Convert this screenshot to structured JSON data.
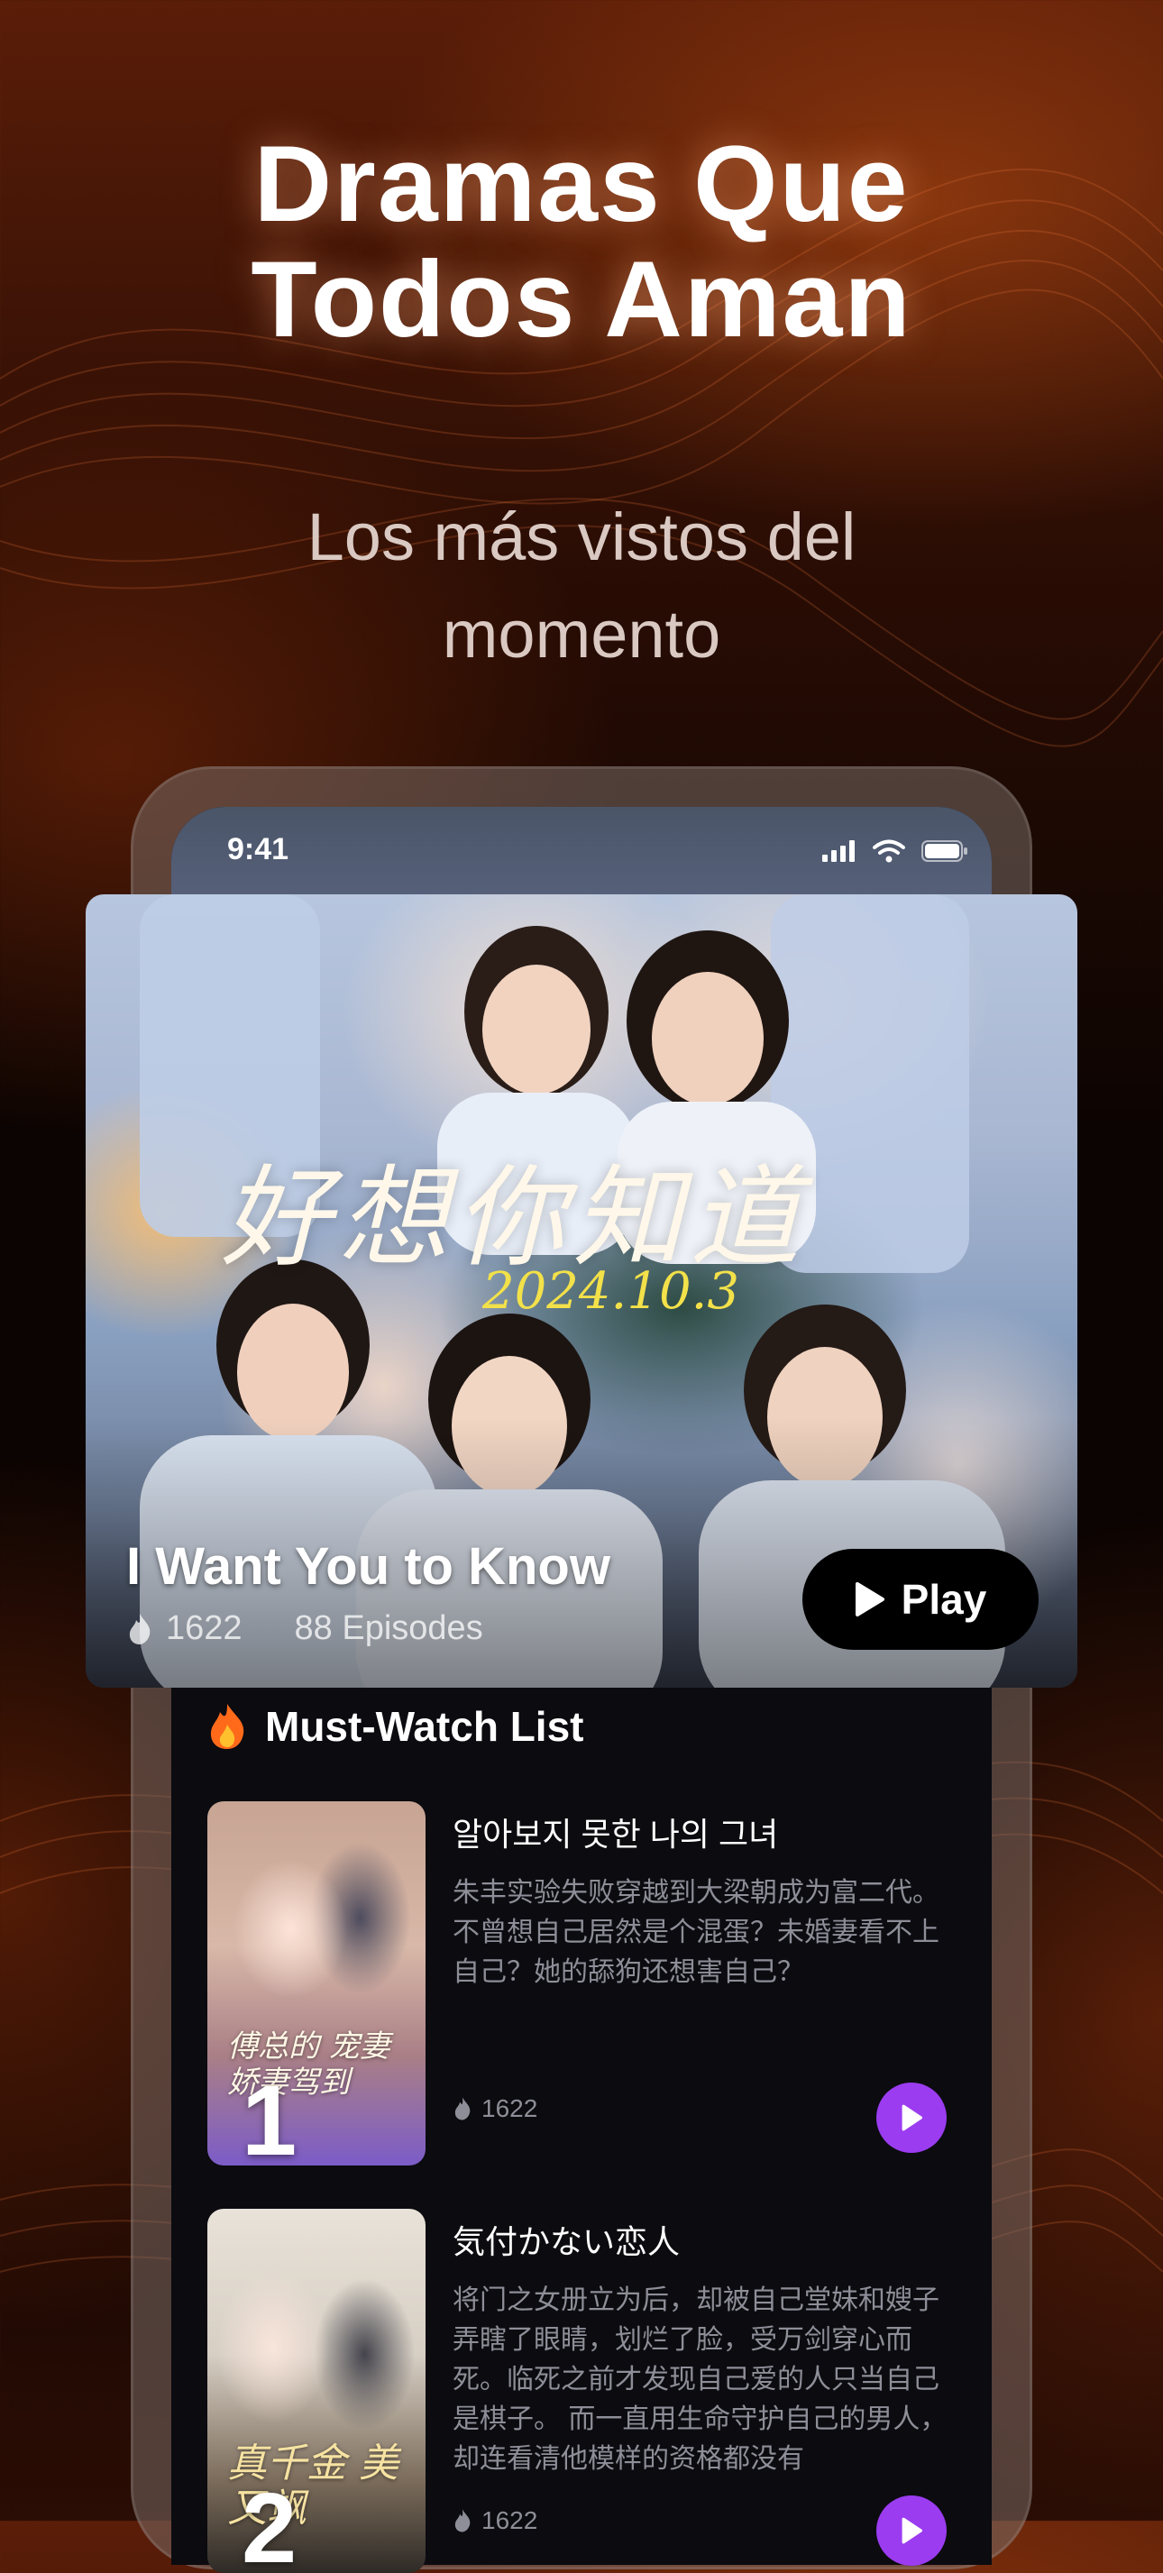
{
  "promo": {
    "headline_line1": "Dramas Que",
    "headline_line2": "Todos Aman",
    "subhead_line1": "Los más vistos del",
    "subhead_line2": "momento"
  },
  "status_bar": {
    "time": "9:41",
    "icons": [
      "signal-icon",
      "wifi-icon",
      "battery-icon"
    ]
  },
  "featured": {
    "poster_title_cn": "好想你知道",
    "poster_date": "2024.10.3",
    "title": "I Want You to Know",
    "views": "1622",
    "episodes": "88 Episodes",
    "play_label": "Play"
  },
  "list": {
    "section_title": "Must-Watch List",
    "section_icon": "fire-icon",
    "items": [
      {
        "rank": "1",
        "poster_text": "傅总的 宠妻 娇妻驾到",
        "title": "알아보지 못한 나의 그녀",
        "description": "朱丰实验失败穿越到大梁朝成为富二代。不曾想自己居然是个混蛋？未婚妻看不上自己？她的舔狗还想害自己？",
        "views": "1622"
      },
      {
        "rank": "2",
        "poster_text": "真千金 美又飒",
        "title": "気付かない恋人",
        "description": "将门之女册立为后，却被自己堂妹和嫂子弄瞎了眼睛，划烂了脸，受万剑穿心而死。临死之前才发现自己爱的人只当自己是棋子。 而一直用生命守护自己的男人，却连看清他模样的资格都没有",
        "views": "1622"
      }
    ]
  },
  "colors": {
    "accent_play": "#9b3cf0",
    "background_glow": "#b8501a",
    "screen_background": "#0b0b10"
  }
}
